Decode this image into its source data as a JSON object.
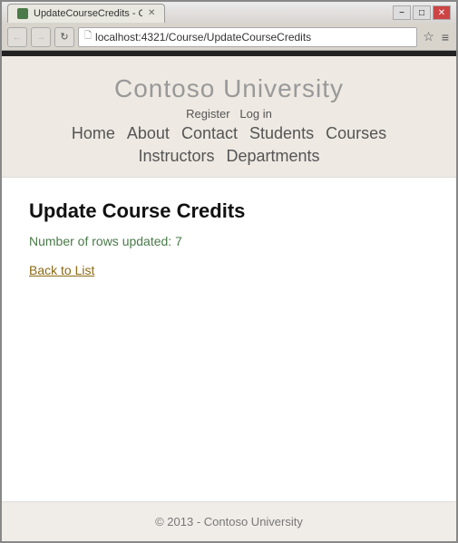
{
  "browser": {
    "title": "UpdateCourseCredits - Co",
    "tab_label": "UpdateCourseCredits - Co",
    "url": "localhost:4321/Course/UpdateCourseCredits",
    "window_controls": {
      "minimize": "−",
      "maximize": "□",
      "close": "✕"
    }
  },
  "site": {
    "title": "Contoso University",
    "auth": {
      "register": "Register",
      "login": "Log in"
    },
    "nav_row1": [
      "Home",
      "About",
      "Contact",
      "Students",
      "Courses"
    ],
    "nav_row2": [
      "Instructors",
      "Departments"
    ]
  },
  "page": {
    "heading": "Update Course Credits",
    "rows_updated_label": "Number of rows updated: 7",
    "back_link": "Back to List"
  },
  "footer": {
    "text": "© 2013 - Contoso University"
  }
}
